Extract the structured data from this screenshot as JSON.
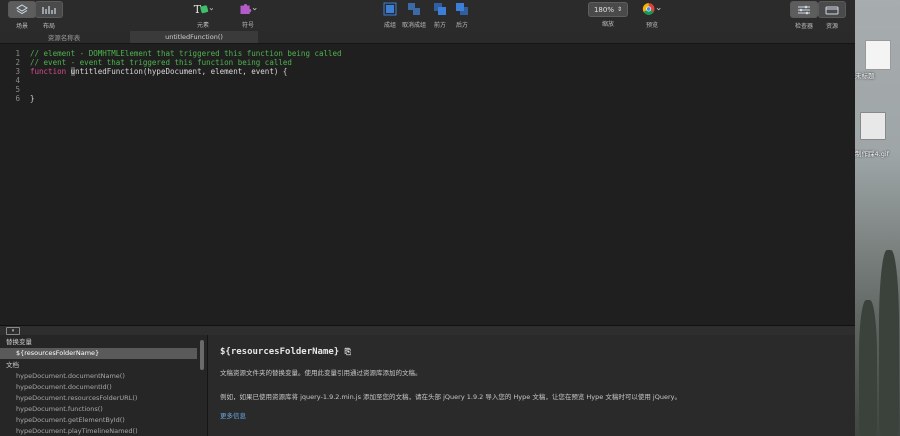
{
  "toolbar": {
    "scenes_label": "场景",
    "layout_label": "布局",
    "elements_label": "元素",
    "symbols_label": "符号",
    "group_label": "成组",
    "ungroup_label": "取消成组",
    "front_label": "前方",
    "back_label": "后方",
    "zoom_value": "180%",
    "zoom_label": "缩放",
    "preview_label": "预览",
    "inspector_label": "检查器",
    "library_label": "资源"
  },
  "tabs": [
    {
      "label": "资源名称表"
    },
    {
      "label": "untitledFunction()"
    }
  ],
  "code": {
    "lines": [
      {
        "num": "1",
        "comment": "// element - DOMHTMLElement that triggered this function being called"
      },
      {
        "num": "2",
        "comment": "// event - event that triggered this function being called"
      },
      {
        "num": "3",
        "keyword": "function",
        "cursor": "u",
        "rest": "ntitledFunction(hypeDocument, element, event) {"
      },
      {
        "num": "4"
      },
      {
        "num": "5"
      },
      {
        "num": "6",
        "rest": "}"
      }
    ]
  },
  "bottom": {
    "collapse_icon": "chevron-down-icon",
    "section_replace": "替换变量",
    "item_selected": "${resourcesFolderName}",
    "section_document": "文档",
    "doc_items": [
      "hypeDocument.documentName()",
      "hypeDocument.documentId()",
      "hypeDocument.resourcesFolderURL()",
      "hypeDocument.functions()",
      "hypeDocument.getElementById()",
      "hypeDocument.playTimelineNamed()"
    ],
    "detail_title": "${resourcesFolderName}",
    "detail_line1": "文稿资源文件夹的替换变量。使用此变量引用通过资源库添加的文稿。",
    "detail_line2": "例如，如果已使用资源库将 jquery-1.9.2.min.js 添加至您的文稿，请在头部 jQuery 1.9.2 导入您的 Hype 文稿，让您在预览 Hype 文稿时可以使用 jQuery。",
    "more_info": "更多信息"
  },
  "desktop": {
    "file1_label": "未标题",
    "file2_label": "制作踩4.gif"
  },
  "colors": {
    "accent_blue": "#3b7fd9",
    "comment_green": "#4fb34f",
    "keyword_pink": "#d94c8a",
    "link_blue": "#6aa9e6"
  }
}
